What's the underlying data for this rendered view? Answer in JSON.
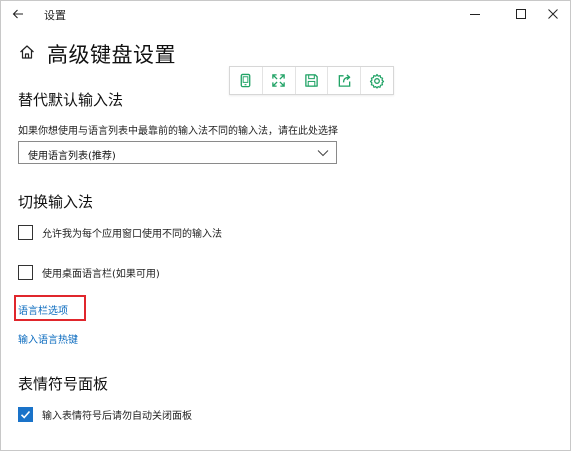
{
  "window": {
    "title": "设置"
  },
  "header": {
    "page_title": "高级键盘设置"
  },
  "toolbar": {
    "buttons": [
      {
        "icon": "tablet-icon"
      },
      {
        "icon": "expand-icon"
      },
      {
        "icon": "save-icon"
      },
      {
        "icon": "share-icon"
      },
      {
        "icon": "gear-icon"
      }
    ],
    "accent_color": "#21a366"
  },
  "override_input": {
    "heading": "替代默认输入法",
    "description": "如果你想使用与语言列表中最靠前的输入法不同的输入法，请在此处选择",
    "dropdown_value": "使用语言列表(推荐)"
  },
  "switch_input": {
    "heading": "切换输入法",
    "options": [
      {
        "label": "允许我为每个应用窗口使用不同的输入法",
        "checked": false
      },
      {
        "label": "使用桌面语言栏(如果可用)",
        "checked": false
      }
    ],
    "links": {
      "language_bar_options": "语言栏选项",
      "input_language_hotkeys": "输入语言热键"
    }
  },
  "emoji_panel": {
    "heading": "表情符号面板",
    "options": [
      {
        "label": "输入表情符号后请勿自动关闭面板",
        "checked": true
      }
    ]
  },
  "colors": {
    "link": "#0b6bbf",
    "checkbox_checked": "#1a73c9",
    "highlight": "#e0262c"
  }
}
